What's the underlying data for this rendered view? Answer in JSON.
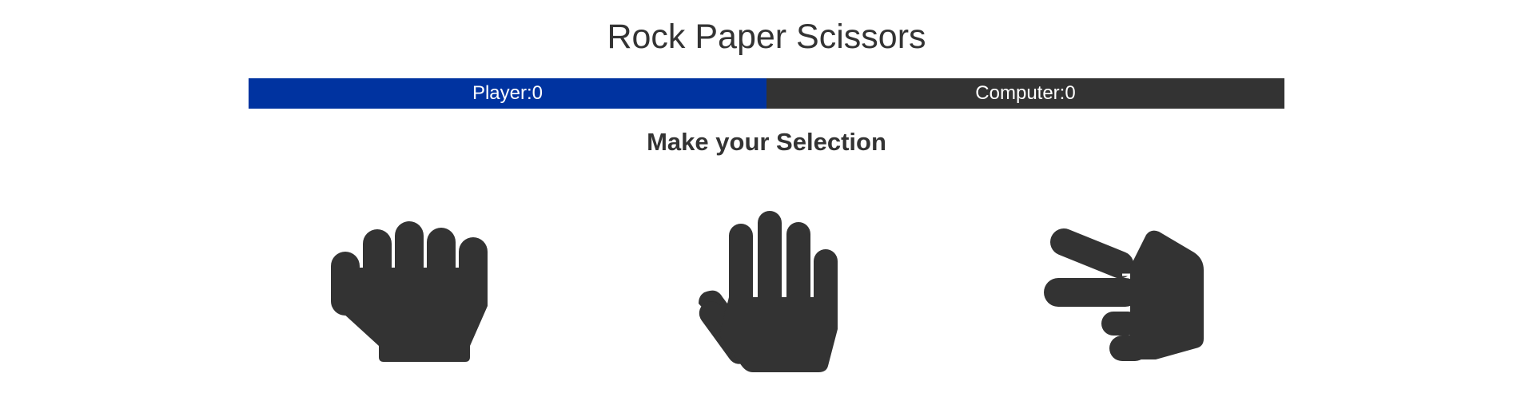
{
  "header": {
    "title": "Rock Paper Scissors"
  },
  "scoreboard": {
    "player_label": "Player:0",
    "computer_label": "Computer:0",
    "player_color": "#0033a0",
    "computer_color": "#333333"
  },
  "prompt": {
    "text": "Make your Selection"
  },
  "choices": [
    {
      "name": "rock",
      "icon": "hand-rock-icon"
    },
    {
      "name": "paper",
      "icon": "hand-paper-icon"
    },
    {
      "name": "scissors",
      "icon": "hand-scissors-icon"
    }
  ]
}
